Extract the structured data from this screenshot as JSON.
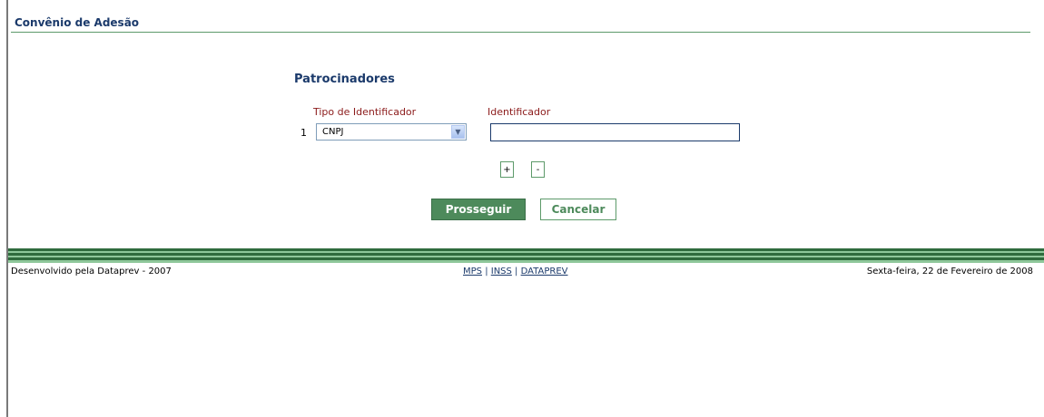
{
  "page": {
    "title": "Convênio de Adesão",
    "section_title": "Patrocinadores"
  },
  "form": {
    "col_tipo_label": "Tipo de Identificador",
    "col_ident_label": "Identificador",
    "row_number": "1",
    "tipo_selected": "CNPJ",
    "identificador_value": "",
    "add_label": "+",
    "remove_label": "-"
  },
  "actions": {
    "prosseguir_label": "Prosseguir",
    "cancelar_label": "Cancelar"
  },
  "footer": {
    "left_text": "Desenvolvido pela Dataprev - 2007",
    "links": [
      "MPS",
      "INSS",
      "DATAPREV"
    ],
    "separator": " | ",
    "date_text": "Sexta-feira, 22 de Fevereiro de 2008"
  },
  "colors": {
    "title_blue": "#1b3a6b",
    "label_red": "#8b1a1a",
    "accent_green": "#4d8a5b"
  }
}
